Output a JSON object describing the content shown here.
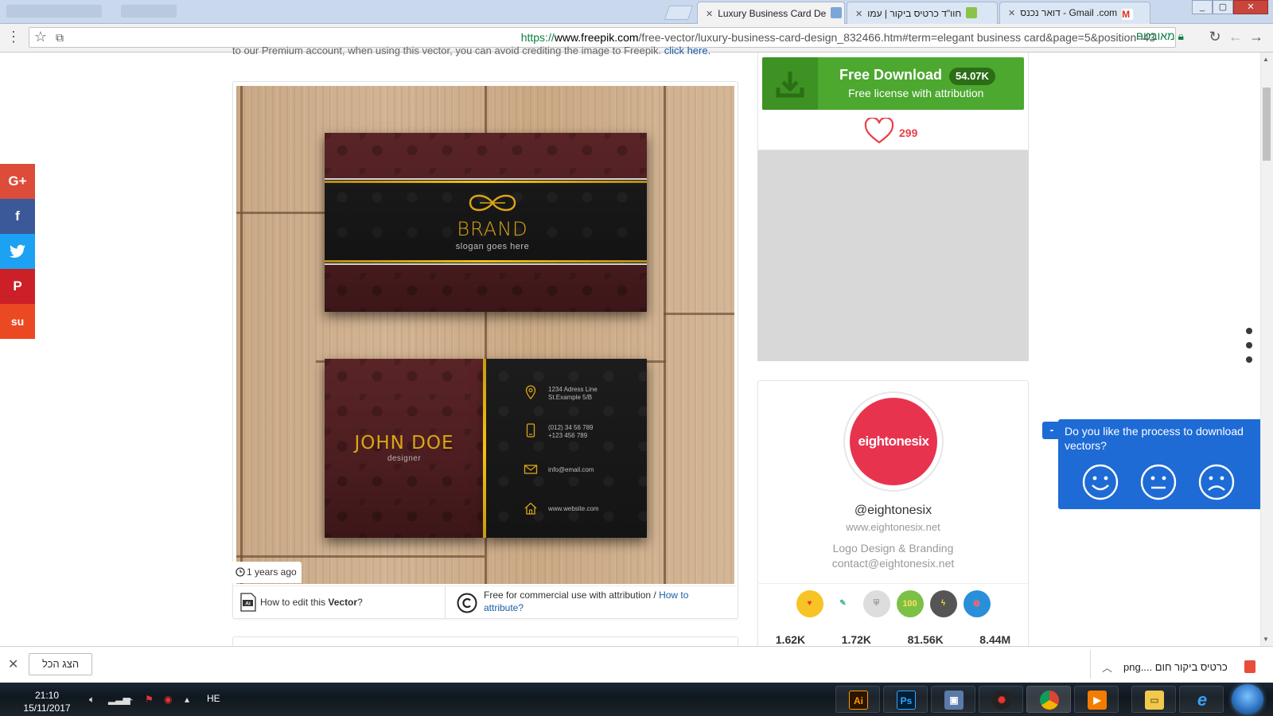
{
  "browser": {
    "tabs": [
      {
        "title": "Luxury Business Card De",
        "active": true
      },
      {
        "title": "חוו\"ד כרטיס ביקור | עמו",
        "active": false
      },
      {
        "title": "דואר נכנס - Gmail .com",
        "active": false
      }
    ],
    "url": {
      "scheme": "https://",
      "host": "www.freepik.com",
      "path": "/free-vector/luxury-business-card-design_832466.htm#term=elegant business card&page=5&position=43"
    },
    "secure_label": "מאובטח"
  },
  "page": {
    "top_cut_text": "to our Premium account, when using this vector, you can avoid crediting the image to Freepik.",
    "top_cut_link": "click here.",
    "preview": {
      "brand_name": "BRAND",
      "brand_slogan": "slogan goes here",
      "person_name": "JOHN DOE",
      "person_role": "designer",
      "address": "1234 Adress Line\nSt.Example 5/B",
      "phone": "(012) 34 56 789\n+123 456 789",
      "email": "info@email.com",
      "website": "www.website.com",
      "time_ago": "1 years ago"
    },
    "edit": {
      "prefix": "How to edit this ",
      "bold": "Vector",
      "suffix": "?"
    },
    "license": {
      "text": "Free for commercial use with attribution / ",
      "link": "How to attribute?"
    }
  },
  "download": {
    "title": "Free Download",
    "count": "54.07K",
    "subtitle": "Free license with attribution",
    "likes": "299"
  },
  "author": {
    "avatar_text": "eightonesix",
    "handle": "@eightonesix",
    "site": "www.eightonesix.net",
    "description": "Logo Design & Branding",
    "contact": "contact@eightonesix.net",
    "stats": [
      "1.62K",
      "1.72K",
      "81.56K",
      "8.44M"
    ],
    "badge_100": "100"
  },
  "feedback": {
    "question": "Do you like the process to download vectors?",
    "tab_symbol": "-"
  },
  "social": [
    {
      "name": "google-plus",
      "glyph": "G+",
      "color": "#dd4b39"
    },
    {
      "name": "facebook",
      "glyph": "f",
      "color": "#3b5998"
    },
    {
      "name": "twitter",
      "glyph": "t",
      "color": "#1da1f2"
    },
    {
      "name": "pinterest",
      "glyph": "P",
      "color": "#cb2027"
    },
    {
      "name": "stumbleupon",
      "glyph": "su",
      "color": "#eb4924"
    }
  ],
  "shelf": {
    "show_all": "הצג הכל",
    "file_name": "png.... כרטיס ביקור חום"
  },
  "taskbar": {
    "time": "21:10",
    "date": "15/11/2017",
    "lang": "HE",
    "apps": [
      "Ai",
      "Ps"
    ]
  }
}
